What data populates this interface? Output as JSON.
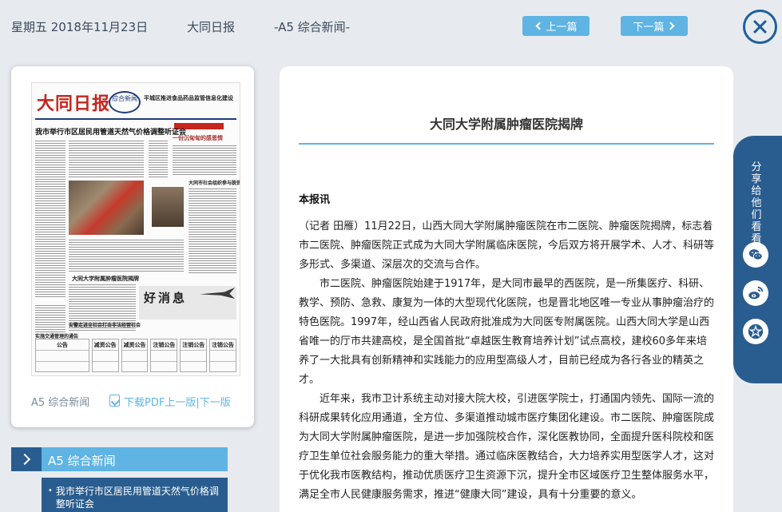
{
  "header": {
    "date": "星期五 2018年11月23日",
    "paper_name": "大同日报",
    "edition": "-A5 综合新闻-",
    "prev_label": "上一篇",
    "next_label": "下一篇"
  },
  "thumbnail": {
    "masthead": "大同日报",
    "badge": "综合新闻",
    "top_headline": "平城区推进食品药品监管信息化建设",
    "main_headline": "我市举行市区居民用管道天然气价格调整听证会",
    "side_heads": [
      "一份沉甸甸的感恩情",
      "大同市社会组织参与脱贫攻坚行动",
      "大同大学附属肿瘤医院揭牌",
      "安警走进全社会打击非法经营社会",
      "实施交通管理的通告"
    ],
    "ad_text": "好消息",
    "notice_cells": [
      "公告",
      "减资公告",
      "减资公告",
      "注销公告",
      "注销公告",
      "注销公告"
    ],
    "section": "A5 综合新闻",
    "pdf_label": "下载PDF",
    "prev_page": "上一版",
    "separator": "|",
    "next_page": "下一版"
  },
  "section_nav": {
    "title": "A5  综合新闻",
    "items": [
      "我市举行市区居民用管道天然气价格调整听证会"
    ]
  },
  "article": {
    "title": "大同大学附属肿瘤医院揭牌",
    "source": "本报讯",
    "paragraphs": [
      "（记者 田雁）11月22日，山西大同大学附属肿瘤医院在市二医院、肿瘤医院揭牌，标志着市二医院、肿瘤医院正式成为大同大学附属临床医院，今后双方将开展学术、人才、科研等多形式、多渠道、深层次的交流与合作。",
      "市二医院、肿瘤医院始建于1917年，是大同市最早的西医院，是一所集医疗、科研、教学、预防、急救、康复为一体的大型现代化医院，也是晋北地区唯一专业从事肿瘤治疗的特色医院。1997年，经山西省人民政府批准成为大同医专附属医院。山西大同大学是山西省唯一的厅市共建高校，是全国首批“卓越医生教育培养计划”试点高校，建校60多年来培养了一大批具有创新精神和实践能力的应用型高级人才，目前已经成为各行各业的精英之才。",
      "近年来，我市卫计系统主动对接大院大校，引进医学院士，打通国内领先、国际一流的科研成果转化应用通道，全方位、多渠道推动城市医疗集团化建设。市二医院、肿瘤医院成为大同大学附属肿瘤医院，是进一步加强院校合作，深化医教协同，全面提升医科院校和医疗卫生单位社会服务能力的重大举措。通过临床医教结合，大力培养实用型医学人才，这对于优化我市医教结构，推动优质医疗卫生资源下沉，提升全市区域医疗卫生整体服务水平，满足全市人民健康服务需求，推进“健康大同”建设，具有十分重要的意义。"
    ]
  },
  "share": {
    "label": "分享给他们看看"
  },
  "colors": {
    "accent": "#5fb4e3",
    "dark_blue": "#2a5d8f",
    "close": "#1f5f9a",
    "background": "#e7ebef"
  }
}
